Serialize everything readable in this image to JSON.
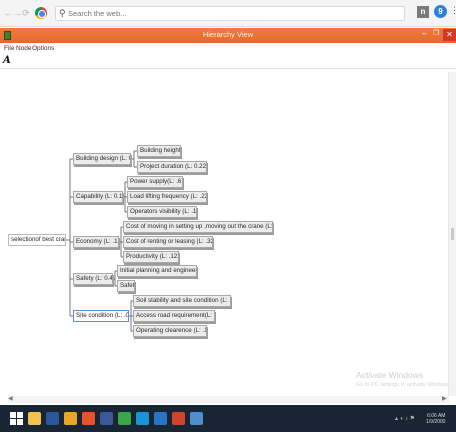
{
  "browser": {
    "search_placeholder": "Search the web...",
    "back": "←",
    "forward": "→",
    "refresh": "⟳",
    "close": "✕",
    "icons": [
      "back-arrow-icon",
      "forward-arrow-icon",
      "refresh-icon",
      "chrome-icon",
      "search-icon",
      "extension-icon",
      "profile-icon",
      "more-menu-icon"
    ]
  },
  "window": {
    "title": "Hierarchy View",
    "minimize": "–",
    "maximize": "❐",
    "close": "✕",
    "accent": "#e8703a"
  },
  "menu": [
    "File",
    "Node",
    "Options"
  ],
  "toolbar": {
    "font_button": "A"
  },
  "tree": {
    "root": "selectionof best cranes",
    "groups": [
      {
        "label": "Building design (L: 0.219)",
        "children": [
          "Building height",
          "Project duration (L: 0.226)"
        ]
      },
      {
        "label": "Capability (L: 0.124)",
        "children": [
          "Power supply(L: .674)",
          "Load lifting frequency (L: .226)",
          "Operators visibility (L: .101)"
        ]
      },
      {
        "label": "Economy (L: .122)",
        "children": [
          "Cost of moving in setting up ,moving out the crane (L: .558)",
          "Cost of renting or leasing (L: .320)",
          "Productivity (L: .122)"
        ]
      },
      {
        "label": "Safety (L: 0.470)",
        "children": [
          "Initial planning and engineering",
          "Safety"
        ]
      },
      {
        "label": "Site condition (L: .066)",
        "children": [
          "Soil stability and site condition (L: .576)",
          "Access road requirement(L: .258)",
          "Operating clearence (L: .158)"
        ]
      }
    ]
  },
  "watermark": {
    "title": "Activate Windows",
    "subtitle": "Go to PC settings to activate Windows."
  },
  "taskbar": {
    "apps": [
      {
        "name": "file-explorer-icon",
        "color": "#f2c14e"
      },
      {
        "name": "word-icon",
        "color": "#2b579a"
      },
      {
        "name": "chrome-taskbar-icon",
        "color": "#e9a52a"
      },
      {
        "name": "firefox-icon",
        "color": "#e5542a"
      },
      {
        "name": "facebook-icon",
        "color": "#3b5998"
      },
      {
        "name": "green-app-icon",
        "color": "#3aa64a"
      },
      {
        "name": "skype-icon",
        "color": "#1796d6"
      },
      {
        "name": "blue-app-icon",
        "color": "#2b74c4"
      },
      {
        "name": "red-app-icon",
        "color": "#d0442e"
      },
      {
        "name": "hierarchy-app-icon",
        "color": "#4f8fcf"
      }
    ],
    "time": "6:06 AM",
    "date": "1/9/2000"
  }
}
